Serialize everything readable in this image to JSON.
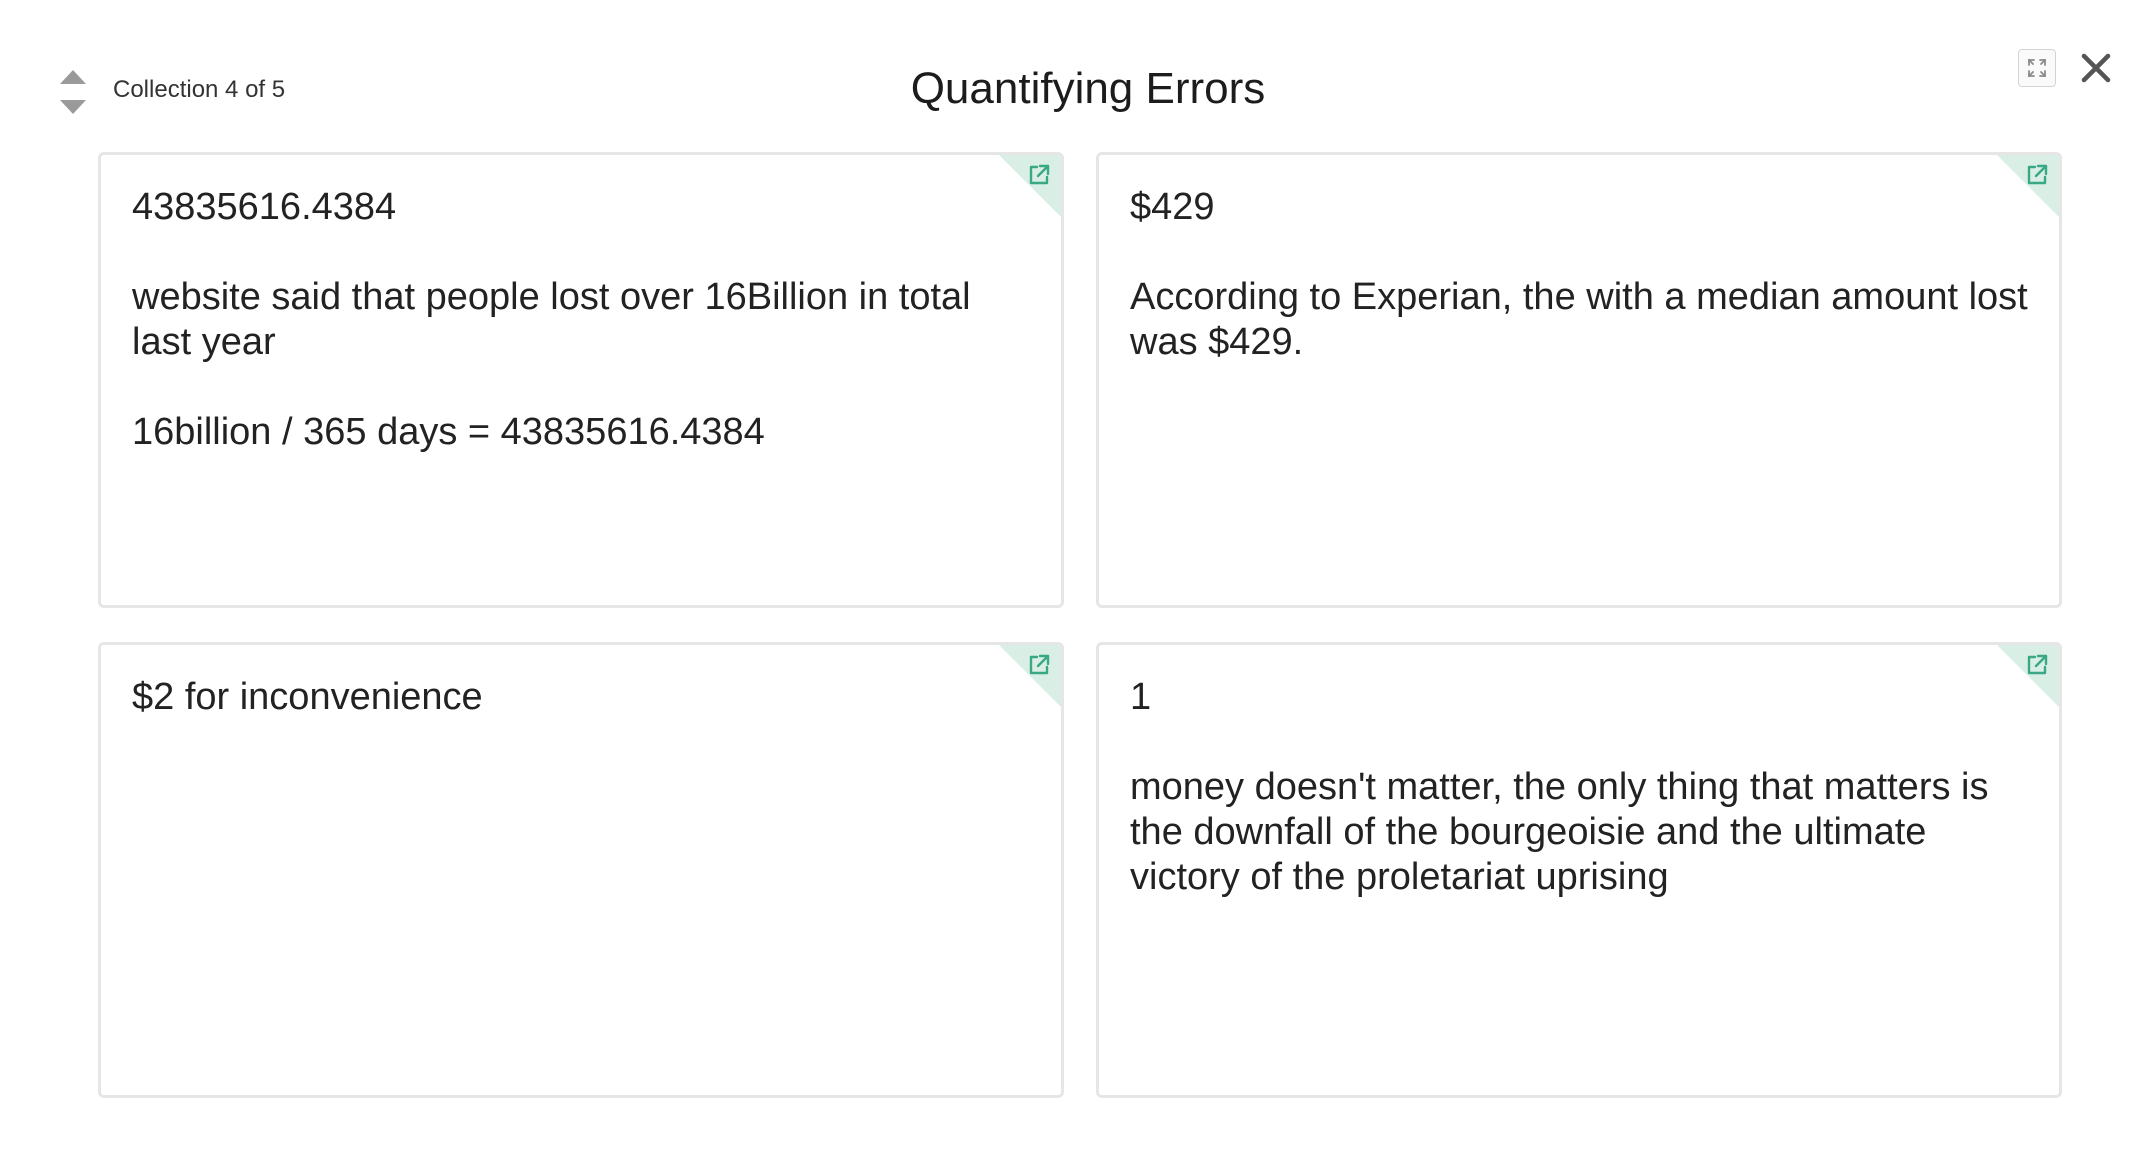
{
  "header": {
    "collection_label": "Collection 4 of 5",
    "title": "Quantifying Errors"
  },
  "icons": {
    "prev": "triangle-up-icon",
    "next": "triangle-down-icon",
    "expand": "fullscreen-icon",
    "close": "close-icon",
    "open_link": "external-link-icon"
  },
  "colors": {
    "accent": "#3aa885",
    "corner": "#d9efe6",
    "border": "#e6e6e6"
  },
  "cards": [
    {
      "value": "43835616.4384",
      "paragraphs": [
        "website said that people lost over 16Billion in total last year",
        "16billion / 365 days = 43835616.4384"
      ]
    },
    {
      "value": "$429",
      "paragraphs": [
        "According to Experian, the with a median amount lost was $429."
      ]
    },
    {
      "value": "$2 for inconvenience",
      "paragraphs": []
    },
    {
      "value": "1",
      "paragraphs": [
        "money doesn't matter, the only thing that matters is the downfall of the bourgeoisie and the ultimate victory of the proletariat uprising"
      ]
    }
  ]
}
